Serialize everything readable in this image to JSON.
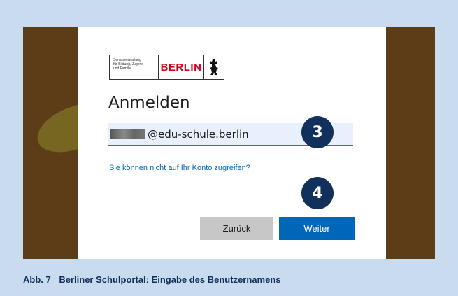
{
  "logo": {
    "small_text": "Senatsverwaltung\nfür Bildung, Jugend\nund Familie",
    "berlin": "BERLIN",
    "bear_icon": "berlin-bear-icon"
  },
  "login": {
    "title": "Anmelden",
    "email_suffix": "@edu-schule.berlin",
    "cannot_access_link": "Sie können nicht auf Ihr Konto zugreifen?",
    "back_label": "Zurück",
    "next_label": "Weiter"
  },
  "markers": {
    "step3": "3",
    "step4": "4"
  },
  "caption": {
    "number": "Abb. 7",
    "text": "Berliner Schulportal: Eingabe des Benutzernamens"
  },
  "colors": {
    "page_bg": "#c9dcef",
    "accent": "#0067b8",
    "marker": "#12305c",
    "brand_red": "#d4011d"
  }
}
